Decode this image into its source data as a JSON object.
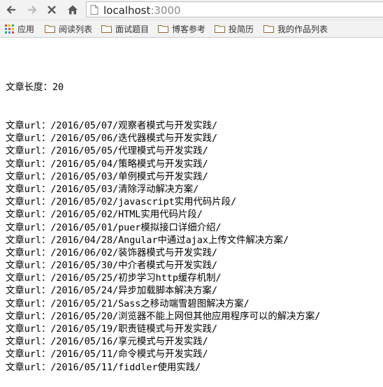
{
  "toolbar": {
    "back_icon": "arrow-left-icon",
    "forward_icon": "arrow-right-icon",
    "stop_icon": "close-icon",
    "home_icon": "home-icon"
  },
  "address": {
    "host": "localhost",
    "port": ":3000"
  },
  "bookmarks": [
    {
      "label": "应用",
      "icon": "apps-grid-icon"
    },
    {
      "label": "阅读列表",
      "icon": "folder-icon"
    },
    {
      "label": "面试题目",
      "icon": "folder-icon"
    },
    {
      "label": "博客参考",
      "icon": "folder-icon"
    },
    {
      "label": "投简历",
      "icon": "folder-icon"
    },
    {
      "label": "我的作品列表",
      "icon": "folder-icon"
    }
  ],
  "content": {
    "length_label": "文章长度：",
    "length_value": "20",
    "url_label": "文章url：",
    "urls": [
      "/2016/05/07/观察者模式与开发实践/",
      "/2016/05/06/迭代器模式与开发实践/",
      "/2016/05/05/代理模式与开发实践/",
      "/2016/05/04/策略模式与开发实践/",
      "/2016/05/03/单例模式与开发实践/",
      "/2016/05/03/清除浮动解决方案/",
      "/2016/05/02/javascript实用代码片段/",
      "/2016/05/02/HTML实用代码片段/",
      "/2016/05/01/puer模拟接口详细介绍/",
      "/2016/04/28/Angular中通过ajax上传文件解决方案/",
      "/2016/06/02/装饰器模式与开发实践/",
      "/2016/05/30/中介者模式与开发实践/",
      "/2016/05/25/初步学习http缓存机制/",
      "/2016/05/24/异步加载脚本解决方案/",
      "/2016/05/21/Sass之移动端雪碧图解决方案/",
      "/2016/05/20/浏览器不能上网但其他应用程序可以的解决方案/",
      "/2016/05/19/职责链模式与开发实践/",
      "/2016/05/16/享元模式与开发实践/",
      "/2016/05/11/命令模式与开发实践/",
      "/2016/05/11/fiddler使用实践/"
    ]
  }
}
